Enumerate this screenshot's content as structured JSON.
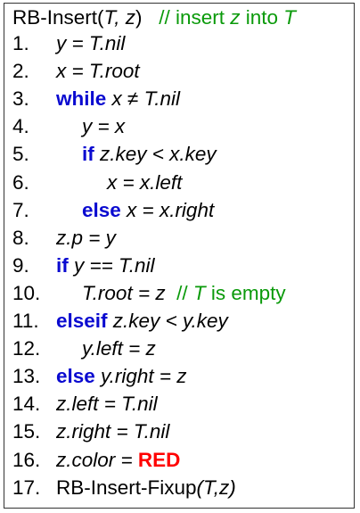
{
  "title": [
    {
      "t": "RB-Insert(",
      "s": "n"
    },
    {
      "t": "T, z",
      "s": "i"
    },
    {
      "t": ")   ",
      "s": "n"
    },
    {
      "t": "// insert ",
      "s": "c"
    },
    {
      "t": "z",
      "s": "ci"
    },
    {
      "t": " into ",
      "s": "c"
    },
    {
      "t": "T",
      "s": "ci"
    }
  ],
  "lines": [
    {
      "num": "1.",
      "indent": 0,
      "segs": [
        {
          "t": "y = T.nil",
          "s": "i"
        }
      ]
    },
    {
      "num": "2.",
      "indent": 0,
      "segs": [
        {
          "t": "x = T.root",
          "s": "i"
        }
      ]
    },
    {
      "num": "3.",
      "indent": 0,
      "segs": [
        {
          "t": "while",
          "s": "kw"
        },
        {
          "t": " x ≠ T.nil",
          "s": "i"
        }
      ]
    },
    {
      "num": "4.",
      "indent": 1,
      "segs": [
        {
          "t": "y = x",
          "s": "i"
        }
      ]
    },
    {
      "num": "5.",
      "indent": 1,
      "segs": [
        {
          "t": "if",
          "s": "kw"
        },
        {
          "t": " z.key < x.key",
          "s": "i"
        }
      ]
    },
    {
      "num": "6.",
      "indent": 2,
      "segs": [
        {
          "t": "x = x.left",
          "s": "i"
        }
      ]
    },
    {
      "num": "7.",
      "indent": 1,
      "segs": [
        {
          "t": "else",
          "s": "kw"
        },
        {
          "t": " x = x.right",
          "s": "i"
        }
      ]
    },
    {
      "num": "8.",
      "indent": 0,
      "segs": [
        {
          "t": "z.p = y",
          "s": "i"
        }
      ]
    },
    {
      "num": "9.",
      "indent": 0,
      "segs": [
        {
          "t": "if",
          "s": "kw"
        },
        {
          "t": " y == T.nil",
          "s": "i"
        }
      ]
    },
    {
      "num": "10.",
      "indent": 1,
      "segs": [
        {
          "t": "T.root = z",
          "s": "i"
        },
        {
          "t": "  // ",
          "s": "c"
        },
        {
          "t": "T",
          "s": "ci"
        },
        {
          "t": " is empty",
          "s": "c"
        }
      ]
    },
    {
      "num": "11.",
      "indent": 0,
      "segs": [
        {
          "t": "elseif",
          "s": "kw"
        },
        {
          "t": " z.key < y.key",
          "s": "i"
        }
      ]
    },
    {
      "num": "12.",
      "indent": 1,
      "segs": [
        {
          "t": "y.left = z",
          "s": "i"
        }
      ]
    },
    {
      "num": "13.",
      "indent": 0,
      "segs": [
        {
          "t": "else",
          "s": "kw"
        },
        {
          "t": " y.right = z",
          "s": "i"
        }
      ]
    },
    {
      "num": "14.",
      "indent": 0,
      "segs": [
        {
          "t": "z.left = T.nil",
          "s": "i"
        }
      ]
    },
    {
      "num": "15.",
      "indent": 0,
      "segs": [
        {
          "t": "z.right = T.nil",
          "s": "i"
        }
      ]
    },
    {
      "num": "16.",
      "indent": 0,
      "segs": [
        {
          "t": "z.color = ",
          "s": "i"
        },
        {
          "t": "RED",
          "s": "red"
        }
      ]
    },
    {
      "num": "17.",
      "indent": 0,
      "segs": [
        {
          "t": "RB-Insert-Fixup",
          "s": "n"
        },
        {
          "t": "(T,z)",
          "s": "i"
        }
      ]
    }
  ]
}
